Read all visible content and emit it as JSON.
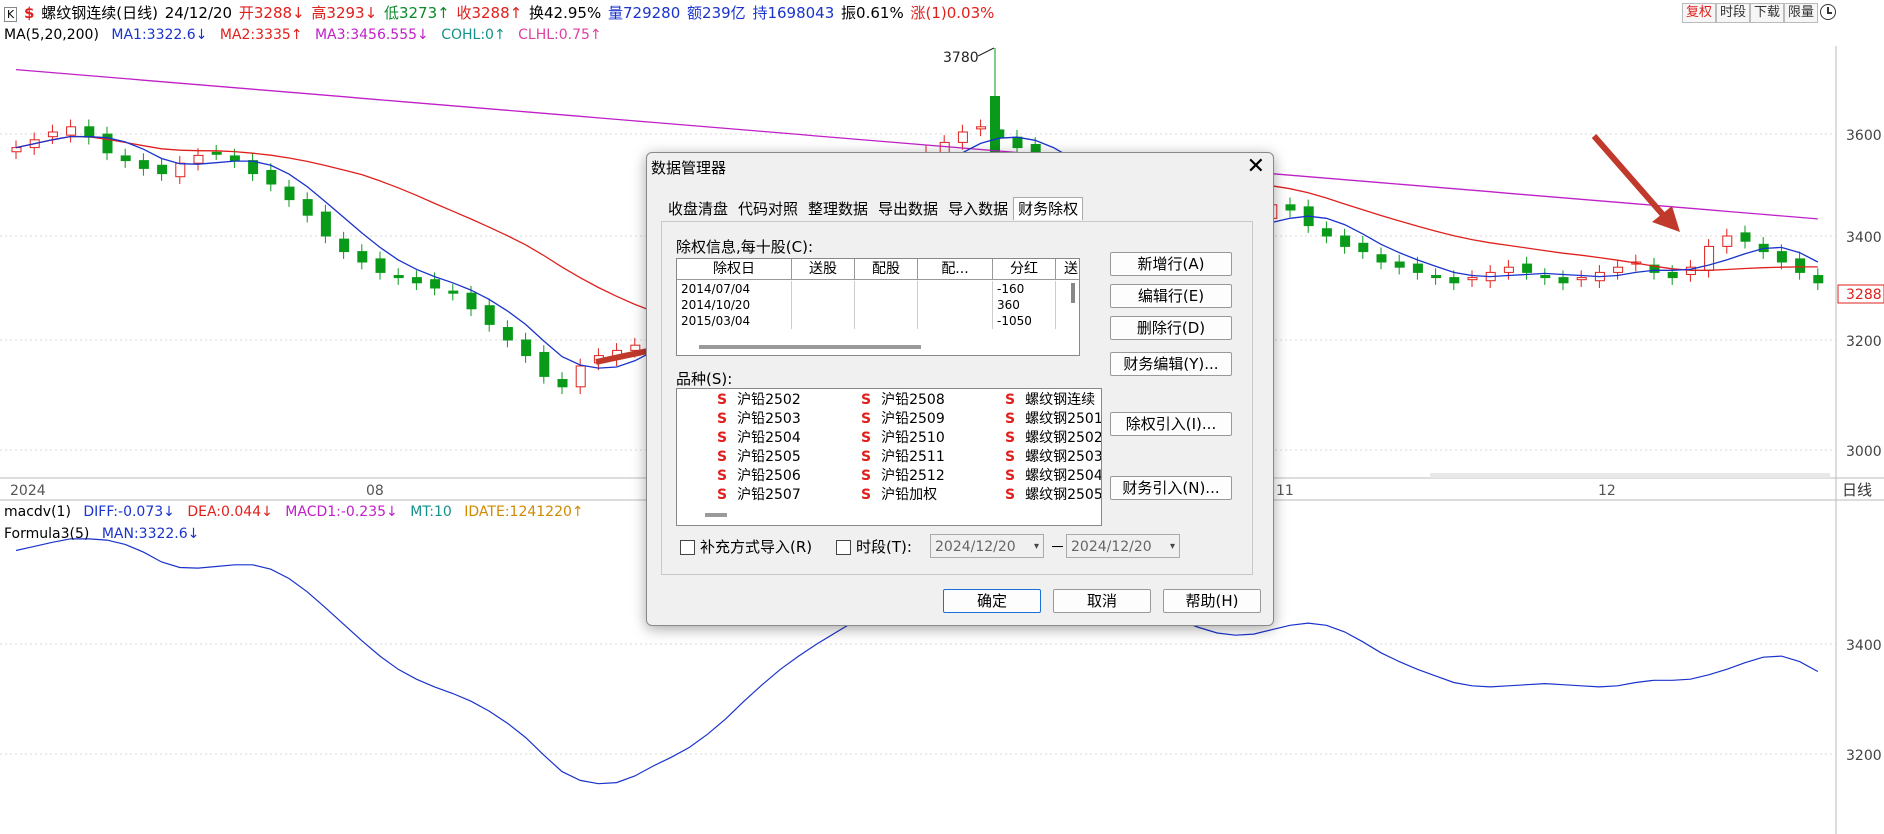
{
  "header": {
    "window_icon": "K",
    "symbol_badge": "$",
    "instrument": "螺纹钢连续(日线)",
    "date": "24/12/20",
    "open": "开3288↓",
    "high": "高3293↓",
    "low": "低3273↑",
    "close": "收3288↑",
    "turnover": "换42.95%",
    "volume": "量729280",
    "amount": "额239亿",
    "open_interest": "持1698043",
    "amplitude": "振0.61%",
    "change": "涨(1)0.03%",
    "buttons": [
      "复权",
      "时段",
      "下载",
      "限量"
    ]
  },
  "ma_line": {
    "label": "MA(5,20,200)",
    "ma1": "MA1:3322.6↓",
    "ma2": "MA2:3335↑",
    "ma3": "MA3:3456.555↓",
    "cohl": "COHL:0↑",
    "clhl": "CLHL:0.75↑"
  },
  "price_axis": {
    "ticks": [
      "3600",
      "3400",
      "3200",
      "3000"
    ],
    "current_price": "3288",
    "peak_label": "3780"
  },
  "time_axis": {
    "labels": [
      "2024",
      "08",
      "11",
      "12"
    ],
    "period": "日线"
  },
  "macd_line": {
    "label": "macdv(1)",
    "diff": "DIFF:-0.073↓",
    "dea": "DEA:0.044↓",
    "macd1": "MACD1:-0.235↓",
    "mt": "MT:10",
    "idate": "IDATE:1241220↑"
  },
  "formula_line": {
    "label": "Formula3(5)",
    "man": "MAN:3322.6↓"
  },
  "lower_axis": {
    "ticks": [
      "3400",
      "3200"
    ]
  },
  "dialog": {
    "title": "数据管理器",
    "close_glyph": "✕",
    "tabs": [
      "收盘清盘",
      "代码对照",
      "整理数据",
      "导出数据",
      "导入数据",
      "财务除权"
    ],
    "active_tab": "财务除权",
    "dividend_label": "除权信息,每十股(C):",
    "table_headers": [
      "除权日",
      "送股",
      "配股",
      "配...",
      "分红",
      "送"
    ],
    "table_rows": [
      [
        "2014/07/04",
        "",
        "",
        "",
        "-160"
      ],
      [
        "2014/10/20",
        "",
        "",
        "",
        "360"
      ],
      [
        "2015/03/04",
        "",
        "",
        "",
        "-1050"
      ]
    ],
    "side_buttons": [
      "新增行(A)",
      "编辑行(E)",
      "删除行(D)",
      "财务编辑(Y)...",
      "除权引入(I)...",
      "财务引入(N)..."
    ],
    "varieties_label": "品种(S):",
    "varieties_col1": [
      "沪铅2502",
      "沪铅2503",
      "沪铅2504",
      "沪铅2505",
      "沪铅2506",
      "沪铅2507"
    ],
    "varieties_col2": [
      "沪铅2508",
      "沪铅2509",
      "沪铅2510",
      "沪铅2511",
      "沪铅2512",
      "沪铅加权"
    ],
    "varieties_col3": [
      "螺纹钢连续",
      "螺纹钢2501",
      "螺纹钢2502",
      "螺纹钢2503",
      "螺纹钢2504",
      "螺纹钢2505"
    ],
    "variety_prefix": "S",
    "supplement_label": "补充方式导入(R)",
    "period_label": "时段(T):",
    "date_from": "2024/12/20",
    "date_to": "2024/12/20",
    "date_sep": "－",
    "ok": "确定",
    "cancel": "取消",
    "help": "帮助(H)"
  },
  "colors": {
    "up": "#e0201c",
    "down": "#0a9a1a",
    "ma1": "#1a33cc",
    "ma2": "#e0201c",
    "ma3": "#c020c8",
    "arrow": "#c0392b"
  }
}
